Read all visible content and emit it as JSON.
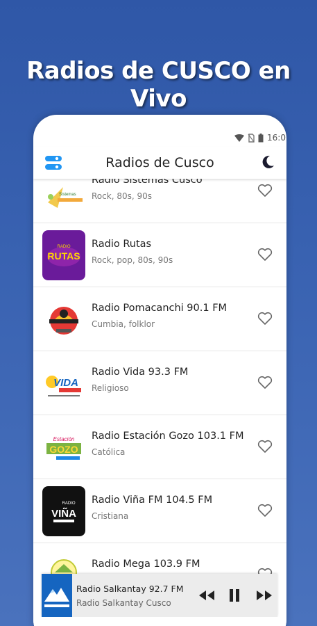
{
  "promo": {
    "title": "Radios de CUSCO en Vivo"
  },
  "status_bar": {
    "time": "16:0"
  },
  "header": {
    "title": "Radios de Cusco"
  },
  "stations": [
    {
      "name": "Radio Sistemas Cusco",
      "genres": "Rock, 80s, 90s",
      "logo_icon": "sistemas-logo",
      "logo_text": "Sistemas"
    },
    {
      "name": "Radio Rutas",
      "genres": "Rock, pop, 80s, 90s",
      "logo_icon": "rutas-logo",
      "logo_text": "RUTAS",
      "logo_sub": "RADIO"
    },
    {
      "name": "Radio Pomacanchi 90.1 FM",
      "genres": "Cumbia, folklor",
      "logo_icon": "pomacanchi-logo"
    },
    {
      "name": "Radio Vida 93.3 FM",
      "genres": "Religioso",
      "logo_icon": "vida-logo",
      "logo_text": "VIDA"
    },
    {
      "name": "Radio Estación Gozo 103.1 FM",
      "genres": "Católica",
      "logo_icon": "gozo-logo",
      "logo_text": "GOZO",
      "logo_sub": "Estación"
    },
    {
      "name": "Radio Viña FM 104.5 FM",
      "genres": "Cristiana",
      "logo_icon": "vina-logo",
      "logo_text": "VIÑA",
      "logo_sub": "RADIO"
    },
    {
      "name": "Radio Mega 103.9 FM",
      "genres": "",
      "logo_icon": "mega-logo"
    }
  ],
  "player": {
    "title": "Radio Salkantay 92.7 FM",
    "subtitle": "Radio Salkantay Cusco",
    "logo_icon": "salkantay-logo"
  },
  "colors": {
    "background": "#3a63b2",
    "menu_icon": "#2196f3",
    "rutas_bg": "#6a1b9a",
    "rutas_text": "#ffd600",
    "vina_bg": "#111111"
  }
}
